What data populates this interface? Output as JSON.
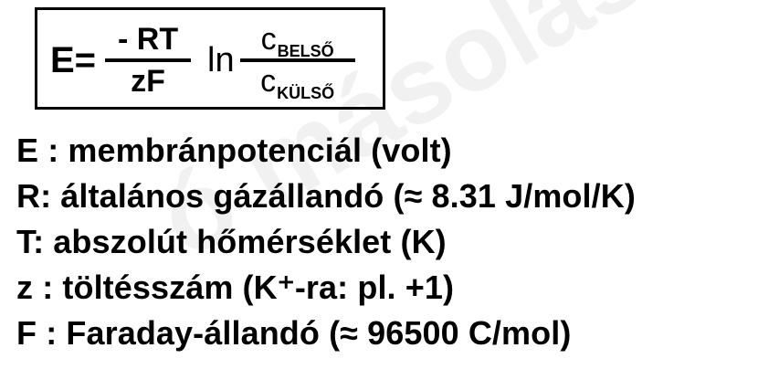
{
  "watermark": "ó másolás engedélye",
  "formula": {
    "lhs": "E=",
    "frac1_num": "- RT",
    "frac1_den": "zF",
    "ln": "ln",
    "frac2_num_base": "c",
    "frac2_num_sub": "BELSŐ",
    "frac2_den_base": "c",
    "frac2_den_sub": "KÜLSŐ"
  },
  "definitions": [
    "E : membránpotenciál (volt)",
    "R: általános gázállandó (≈ 8.31 J/mol/K)",
    "T: abszolút hőmérséklet (K)",
    "z : töltésszám (K⁺-ra: pl. +1)",
    "F : Faraday-állandó (≈ 96500 C/mol)"
  ]
}
